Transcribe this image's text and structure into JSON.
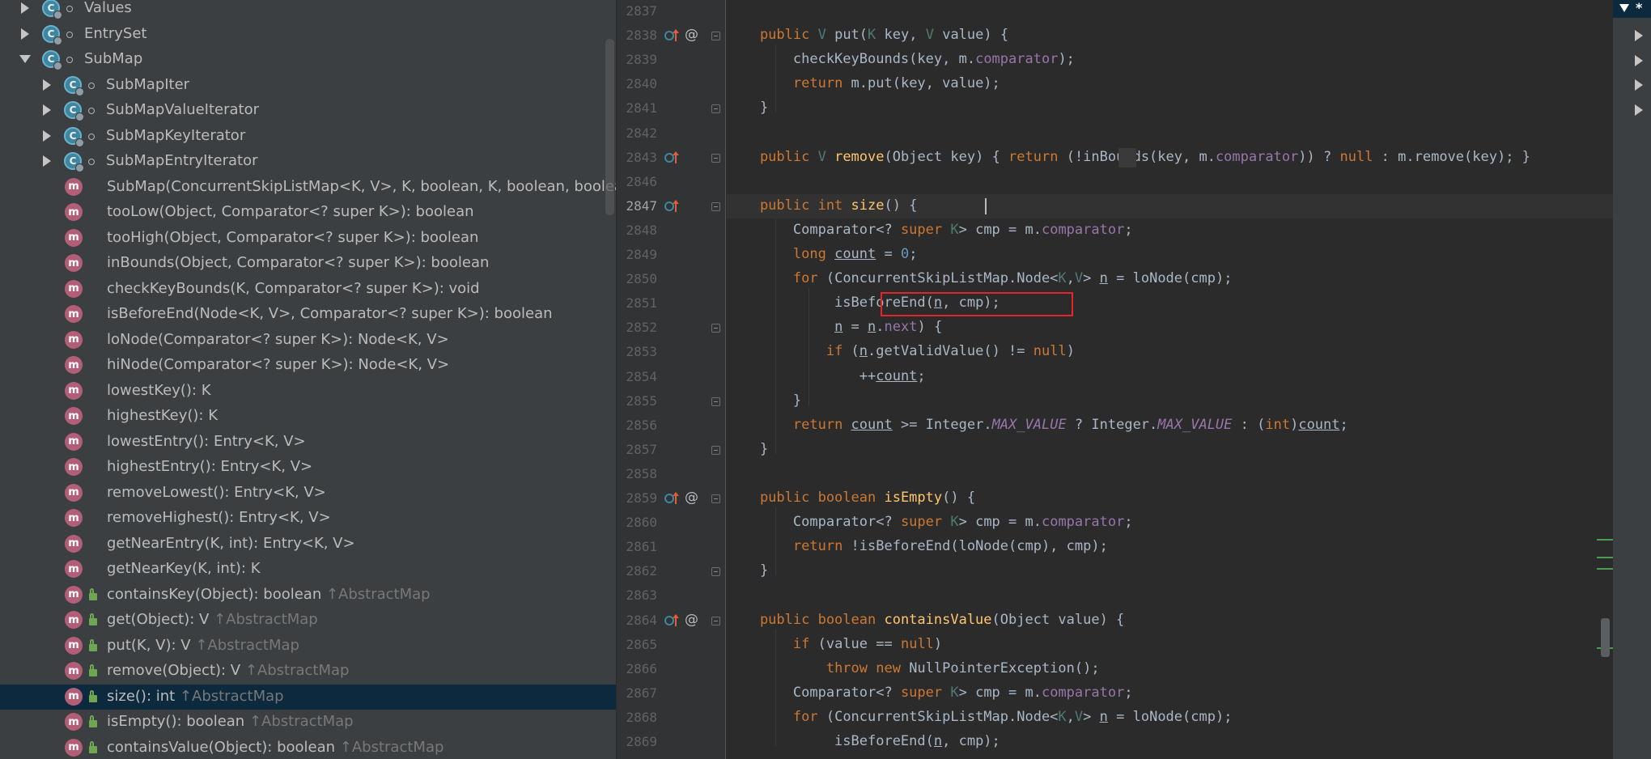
{
  "colors": {
    "keyword": "#CC7832",
    "method_decl": "#FFC66D",
    "field": "#9876AA",
    "default_text": "#A9B7C6",
    "type_param": "#507874",
    "number": "#6897BB",
    "highlight_box": "#E0252C",
    "selection": "#0D293E"
  },
  "structure": {
    "items": [
      {
        "label": "Values",
        "icon": "class-icon",
        "expand": "collapsed",
        "inherited": ""
      },
      {
        "label": "EntrySet",
        "icon": "class-icon",
        "expand": "collapsed",
        "inherited": ""
      },
      {
        "label": "SubMap",
        "icon": "class-icon",
        "expand": "expanded",
        "inherited": ""
      },
      {
        "label": "SubMapIter",
        "icon": "class-icon",
        "expand": "collapsed",
        "inherited": ""
      },
      {
        "label": "SubMapValueIterator",
        "icon": "class-icon",
        "expand": "collapsed",
        "inherited": ""
      },
      {
        "label": "SubMapKeyIterator",
        "icon": "class-icon",
        "expand": "collapsed",
        "inherited": ""
      },
      {
        "label": "SubMapEntryIterator",
        "icon": "class-icon",
        "expand": "collapsed",
        "inherited": ""
      },
      {
        "label": "SubMap(ConcurrentSkipListMap<K, V>, K, boolean, K, boolean, boolean)",
        "icon": "method-icon",
        "inherited": ""
      },
      {
        "label": "tooLow(Object, Comparator<? super K>): boolean",
        "icon": "method-icon",
        "inherited": ""
      },
      {
        "label": "tooHigh(Object, Comparator<? super K>): boolean",
        "icon": "method-icon",
        "inherited": ""
      },
      {
        "label": "inBounds(Object, Comparator<? super K>): boolean",
        "icon": "method-icon",
        "inherited": ""
      },
      {
        "label": "checkKeyBounds(K, Comparator<? super K>): void",
        "icon": "method-icon",
        "inherited": ""
      },
      {
        "label": "isBeforeEnd(Node<K, V>, Comparator<? super K>): boolean",
        "icon": "method-icon",
        "inherited": ""
      },
      {
        "label": "loNode(Comparator<? super K>): Node<K, V>",
        "icon": "method-icon",
        "inherited": ""
      },
      {
        "label": "hiNode(Comparator<? super K>): Node<K, V>",
        "icon": "method-icon",
        "inherited": ""
      },
      {
        "label": "lowestKey(): K",
        "icon": "method-icon",
        "inherited": ""
      },
      {
        "label": "highestKey(): K",
        "icon": "method-icon",
        "inherited": ""
      },
      {
        "label": "lowestEntry(): Entry<K, V>",
        "icon": "method-icon",
        "inherited": ""
      },
      {
        "label": "highestEntry(): Entry<K, V>",
        "icon": "method-icon",
        "inherited": ""
      },
      {
        "label": "removeLowest(): Entry<K, V>",
        "icon": "method-icon",
        "inherited": ""
      },
      {
        "label": "removeHighest(): Entry<K, V>",
        "icon": "method-icon",
        "inherited": ""
      },
      {
        "label": "getNearEntry(K, int): Entry<K, V>",
        "icon": "method-icon",
        "inherited": ""
      },
      {
        "label": "getNearKey(K, int): K",
        "icon": "method-icon",
        "inherited": ""
      },
      {
        "label": "containsKey(Object): boolean ",
        "icon": "method-icon",
        "public": true,
        "inherited": "↑AbstractMap"
      },
      {
        "label": "get(Object): V ",
        "icon": "method-icon",
        "public": true,
        "inherited": "↑AbstractMap"
      },
      {
        "label": "put(K, V): V ",
        "icon": "method-icon",
        "public": true,
        "inherited": "↑AbstractMap"
      },
      {
        "label": "remove(Object): V ",
        "icon": "method-icon",
        "public": true,
        "inherited": "↑AbstractMap"
      },
      {
        "label": "size(): int ",
        "icon": "method-icon",
        "public": true,
        "selected": true,
        "inherited": "↑AbstractMap"
      },
      {
        "label": "isEmpty(): boolean ",
        "icon": "method-icon",
        "public": true,
        "inherited": "↑AbstractMap"
      },
      {
        "label": "containsValue(Object): boolean ",
        "icon": "method-icon",
        "public": true,
        "inherited": "↑AbstractMap"
      }
    ]
  },
  "editor": {
    "line_numbers": [
      "2837",
      "2838",
      "2839",
      "2840",
      "2841",
      "2842",
      "2843",
      "2846",
      "2847",
      "2848",
      "2849",
      "2850",
      "2851",
      "2852",
      "2853",
      "2854",
      "2855",
      "2856",
      "2857",
      "2858",
      "2859",
      "2860",
      "2861",
      "2862",
      "2863",
      "2864",
      "2865",
      "2866",
      "2867",
      "2868",
      "2869"
    ],
    "current_line": "2847",
    "lines": [
      [],
      [
        [
          "    public ",
          "kw"
        ],
        [
          "V ",
          "tp"
        ],
        [
          "put",
          ""
        ],
        [
          "(",
          ""
        ],
        [
          "K ",
          "tp"
        ],
        [
          "key, ",
          ""
        ],
        [
          "V ",
          "tp"
        ],
        [
          "value) {",
          ""
        ]
      ],
      [
        [
          "        checkKeyBounds(key, ",
          ""
        ],
        [
          "m",
          ""
        ],
        [
          ".",
          ""
        ],
        [
          "comparator",
          "fd"
        ],
        [
          ");",
          ""
        ]
      ],
      [
        [
          "        ",
          ""
        ],
        [
          "return ",
          "kw"
        ],
        [
          "m.put(key, value);",
          ""
        ]
      ],
      [
        [
          "    }",
          ""
        ]
      ],
      [],
      [
        [
          "    public ",
          "kw"
        ],
        [
          "V ",
          "tp"
        ],
        [
          "remove",
          "fn"
        ],
        [
          "(Object key) ",
          ""
        ],
        [
          "{ ",
          ""
        ],
        [
          "return ",
          "kw"
        ],
        [
          "(!inBounds(key, m.",
          ""
        ],
        [
          "comparator",
          "fd"
        ],
        [
          ")) ? ",
          ""
        ],
        [
          "null ",
          "kw"
        ],
        [
          ": m.remove(key); ",
          ""
        ],
        [
          "}",
          ""
        ]
      ],
      [],
      [
        [
          "    public int ",
          "kw"
        ],
        [
          "size",
          "fn"
        ],
        [
          "() {",
          ""
        ]
      ],
      [
        [
          "        Comparator<? ",
          ""
        ],
        [
          "super ",
          "kw"
        ],
        [
          "K",
          "tp"
        ],
        [
          "> cmp = m.",
          ""
        ],
        [
          "comparator",
          "fd"
        ],
        [
          ";",
          ""
        ]
      ],
      [
        [
          "        ",
          ""
        ],
        [
          "long ",
          "kw"
        ],
        [
          "count",
          "ul"
        ],
        [
          " = ",
          ""
        ],
        [
          "0",
          "num"
        ],
        [
          ";",
          ""
        ]
      ],
      [
        [
          "        ",
          ""
        ],
        [
          "for ",
          "kw"
        ],
        [
          "(ConcurrentSkipListMap.Node<",
          ""
        ],
        [
          "K",
          "tp"
        ],
        [
          ",",
          ""
        ],
        [
          "V",
          "tp"
        ],
        [
          "> ",
          ""
        ],
        [
          "n",
          "ul"
        ],
        [
          " = loNode(cmp);",
          ""
        ]
      ],
      [
        [
          "             isBeforeEnd(",
          ""
        ],
        [
          "n",
          "ul"
        ],
        [
          ", cmp);",
          ""
        ]
      ],
      [
        [
          "             ",
          ""
        ],
        [
          "n",
          "ul"
        ],
        [
          " = ",
          ""
        ],
        [
          "n",
          "ul"
        ],
        [
          ".",
          ""
        ],
        [
          "next",
          "fd"
        ],
        [
          ") {",
          ""
        ]
      ],
      [
        [
          "            ",
          ""
        ],
        [
          "if ",
          "kw"
        ],
        [
          "(",
          ""
        ],
        [
          "n",
          "ul"
        ],
        [
          ".getValidValue() != ",
          ""
        ],
        [
          "null",
          "kw"
        ],
        [
          ")",
          ""
        ]
      ],
      [
        [
          "                ++",
          ""
        ],
        [
          "count",
          "ul"
        ],
        [
          ";",
          ""
        ]
      ],
      [
        [
          "        }",
          ""
        ]
      ],
      [
        [
          "        ",
          ""
        ],
        [
          "return ",
          "kw"
        ],
        [
          "count",
          "ul"
        ],
        [
          " >= Integer.",
          ""
        ],
        [
          "MAX_VALUE",
          "fd it"
        ],
        [
          " ? Integer.",
          ""
        ],
        [
          "MAX_VALUE",
          "fd it"
        ],
        [
          " : (",
          ""
        ],
        [
          "int",
          "kw"
        ],
        [
          ")",
          ""
        ],
        [
          "count",
          "ul"
        ],
        [
          ";",
          ""
        ]
      ],
      [
        [
          "    }",
          ""
        ]
      ],
      [],
      [
        [
          "    public boolean ",
          "kw"
        ],
        [
          "isEmpty",
          "fn"
        ],
        [
          "() {",
          ""
        ]
      ],
      [
        [
          "        Comparator<? ",
          ""
        ],
        [
          "super ",
          "kw"
        ],
        [
          "K",
          "tp"
        ],
        [
          "> cmp = m.",
          ""
        ],
        [
          "comparator",
          "fd"
        ],
        [
          ";",
          ""
        ]
      ],
      [
        [
          "        ",
          ""
        ],
        [
          "return ",
          "kw"
        ],
        [
          "!isBeforeEnd(loNode(cmp), cmp);",
          ""
        ]
      ],
      [
        [
          "    }",
          ""
        ]
      ],
      [],
      [
        [
          "    public boolean ",
          "kw"
        ],
        [
          "containsValue",
          "fn"
        ],
        [
          "(Object value) {",
          ""
        ]
      ],
      [
        [
          "        ",
          ""
        ],
        [
          "if ",
          "kw"
        ],
        [
          "(value == ",
          ""
        ],
        [
          "null",
          "kw"
        ],
        [
          ")",
          ""
        ]
      ],
      [
        [
          "            ",
          ""
        ],
        [
          "throw new ",
          "kw"
        ],
        [
          "NullPointerException();",
          ""
        ]
      ],
      [
        [
          "        Comparator<? ",
          ""
        ],
        [
          "super ",
          "kw"
        ],
        [
          "K",
          "tp"
        ],
        [
          "> cmp = m.",
          ""
        ],
        [
          "comparator",
          "fd"
        ],
        [
          ";",
          ""
        ]
      ],
      [
        [
          "        ",
          ""
        ],
        [
          "for ",
          "kw"
        ],
        [
          "(ConcurrentSkipListMap.Node<",
          ""
        ],
        [
          "K",
          "tp"
        ],
        [
          ",",
          ""
        ],
        [
          "V",
          "tp"
        ],
        [
          "> ",
          ""
        ],
        [
          "n",
          "ul"
        ],
        [
          " = loNode(cmp);",
          ""
        ]
      ],
      [
        [
          "             isBeforeEnd(",
          ""
        ],
        [
          "n",
          "ul"
        ],
        [
          ", cmp);",
          ""
        ]
      ]
    ]
  },
  "right_panel": {
    "label": "*"
  }
}
